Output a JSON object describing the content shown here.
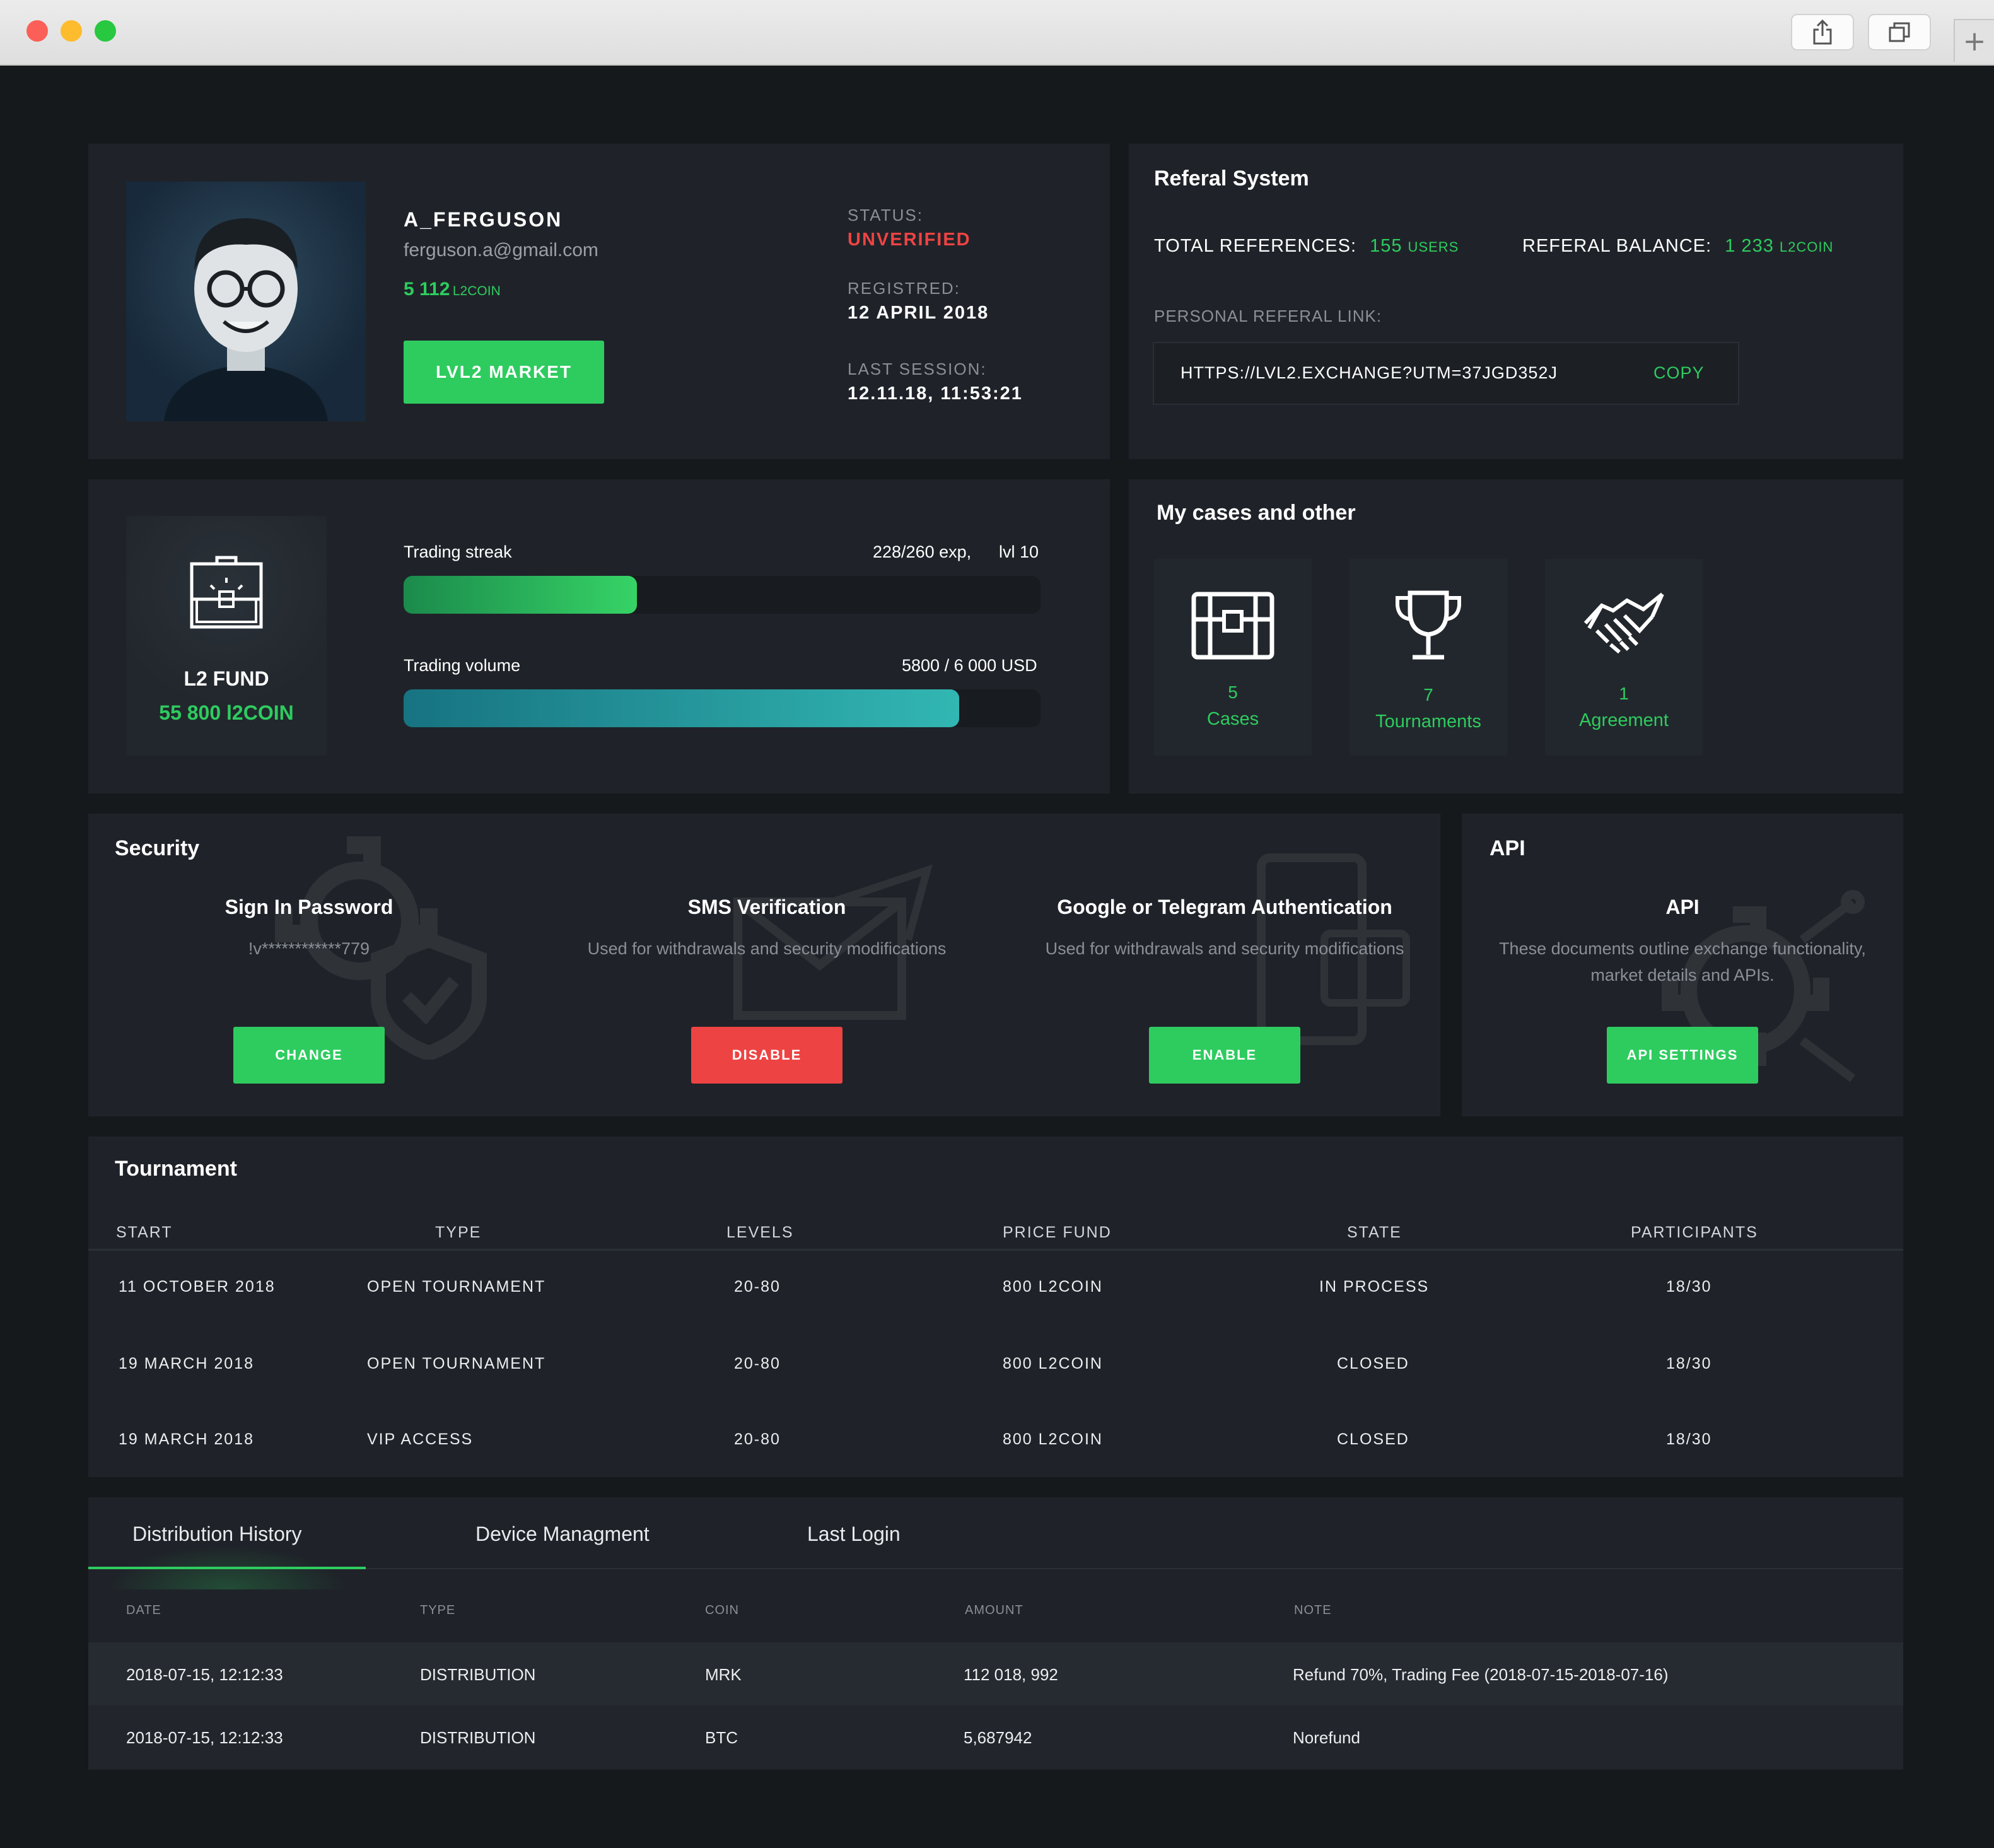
{
  "profile": {
    "username": "A_FERGUSON",
    "email": "ferguson.a@gmail.com",
    "balance_value": "5 112",
    "balance_unit": "L2COIN",
    "market_button": "LVL2 MARKET",
    "status_label": "STATUS:",
    "status_value": "UNVERIFIED",
    "registered_label": "REGISTRED:",
    "registered_value": "12 APRIL 2018",
    "last_session_label": "LAST SESSION:",
    "last_session_value": "12.11.18, 11:53:21"
  },
  "referral": {
    "title": "Referal System",
    "total_label": "TOTAL REFERENCES:",
    "total_value": "155",
    "total_unit": "USERS",
    "balance_label": "REFERAL BALANCE:",
    "balance_value": "1 233",
    "balance_unit": "L2COIN",
    "link_label": "PERSONAL REFERAL LINK:",
    "link_value": "HTTPS://LVL2.EXCHANGE?UTM=37JGD352J",
    "copy_label": "COPY"
  },
  "fund": {
    "title": "L2 FUND",
    "value": "55 800 l2COIN",
    "icon": "treasure-chest-icon"
  },
  "progress": {
    "streak_label": "Trading streak",
    "streak_exp": "228/260 exp,",
    "streak_level": "lvl 10",
    "streak_fraction": 0.366,
    "volume_label": "Trading volume",
    "volume_value": "5800 / 6 000 USD",
    "volume_fraction": 0.872
  },
  "cases": {
    "title": "My cases and other",
    "items": [
      {
        "count": "5",
        "label": "Cases",
        "icon": "treasure-chest-icon"
      },
      {
        "count": "7",
        "label": "Tournaments",
        "icon": "trophy-icon"
      },
      {
        "count": "1",
        "label": "Agreement",
        "icon": "handshake-icon"
      }
    ]
  },
  "security": {
    "title": "Security",
    "items": [
      {
        "title": "Sign In Password",
        "desc": "!v************779",
        "button": "CHANGE"
      },
      {
        "title": "SMS Verification",
        "desc": "Used for withdrawals and security modifications",
        "button": "DISABLE"
      },
      {
        "title": "Google or Telegram Authentication",
        "desc": "Used for withdrawals and security modifications",
        "button": "ENABLE"
      }
    ]
  },
  "api": {
    "title": "API",
    "subtitle": "API",
    "desc_line1": "These documents outline exchange functionality,",
    "desc_line2": "market details and APIs.",
    "button": "API SETTINGS"
  },
  "tournament": {
    "title": "Tournament",
    "headers": [
      "START",
      "TYPE",
      "LEVELS",
      "PRICE FUND",
      "STATE",
      "PARTICIPANTS"
    ],
    "rows": [
      [
        "11 OCTOBER 2018",
        "OPEN TOURNAMENT",
        "20-80",
        "800 L2COIN",
        "IN PROCESS",
        "18/30"
      ],
      [
        "19 MARCH 2018",
        "OPEN TOURNAMENT",
        "20-80",
        "800 L2COIN",
        "CLOSED",
        "18/30"
      ],
      [
        "19 MARCH 2018",
        "VIP ACCESS",
        "20-80",
        "800 L2COIN",
        "CLOSED",
        "18/30"
      ]
    ]
  },
  "history": {
    "tabs": [
      "Distribution History",
      "Device Managment",
      "Last Login"
    ],
    "active_tab": 0,
    "headers": [
      "DATE",
      "TYPE",
      "COIN",
      "AMOUNT",
      "NOTE"
    ],
    "rows": [
      [
        "2018-07-15, 12:12:33",
        "DISTRIBUTION",
        "MRK",
        "112 018, 992",
        "Refund 70%, Trading Fee (2018-07-15-2018-07-16)"
      ],
      [
        "2018-07-15, 12:12:33",
        "DISTRIBUTION",
        "BTC",
        "5,687942",
        "Norefund"
      ]
    ]
  },
  "colors": {
    "accent": "#2ecc5f",
    "danger": "#ee4343",
    "panel": "#1f2329",
    "background": "#16191c"
  }
}
